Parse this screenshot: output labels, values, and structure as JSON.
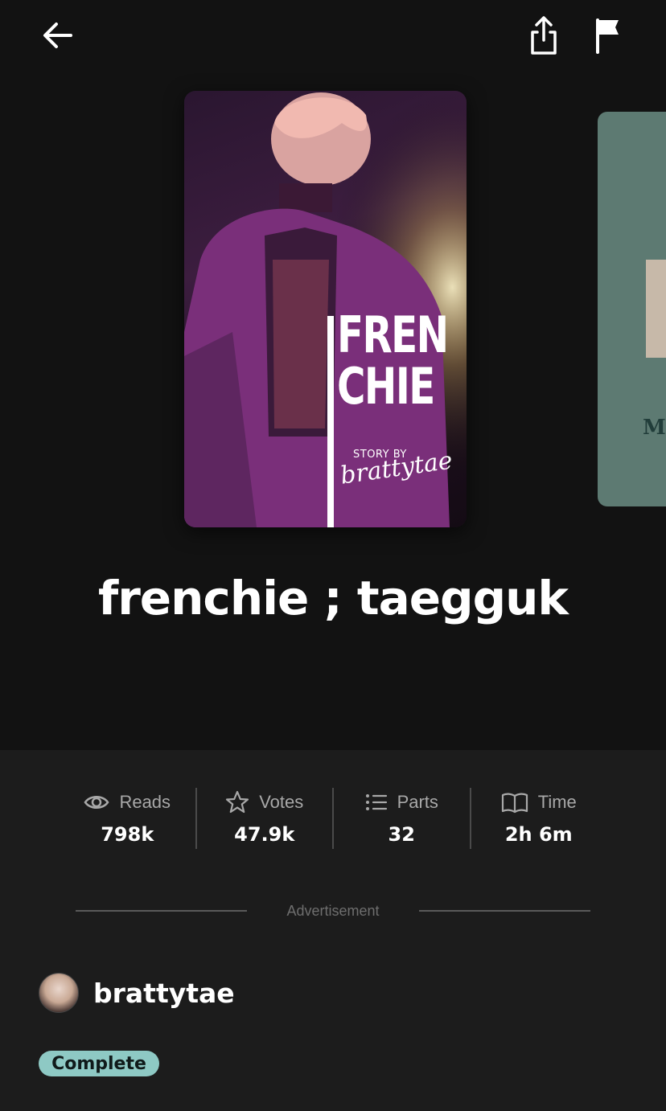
{
  "story": {
    "title": "frenchie ; taegguk",
    "cover": {
      "title_line1": "FREN",
      "title_line2": "CHIE",
      "story_by": "STORY BY",
      "author_script": "brattytae"
    },
    "next_cover_letter": "M"
  },
  "stats": [
    {
      "icon": "eye-icon",
      "label": "Reads",
      "value": "798k"
    },
    {
      "icon": "star-icon",
      "label": "Votes",
      "value": "47.9k"
    },
    {
      "icon": "list-icon",
      "label": "Parts",
      "value": "32"
    },
    {
      "icon": "book-icon",
      "label": "Time",
      "value": "2h 6m"
    }
  ],
  "ad": {
    "label": "Advertisement"
  },
  "author": {
    "name": "brattytae"
  },
  "status": {
    "label": "Complete",
    "color": "#8ec9c4"
  },
  "colors": {
    "hero_bg": "#121212",
    "body_bg": "#1c1c1c",
    "accent": "#8ec9c4"
  }
}
